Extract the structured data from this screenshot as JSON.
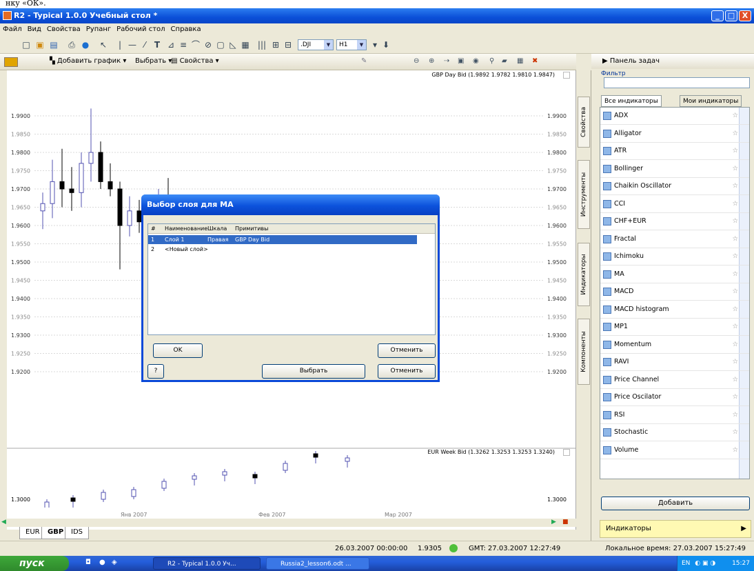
{
  "top_text": "нку «ОК».",
  "window": {
    "title": "R2 - Typical 1.0.0 Учебный стол *",
    "min": "_",
    "max": "□",
    "close": "X"
  },
  "menu": [
    "Файл",
    "Вид",
    "Свойства",
    "Рупанг",
    "Рабочий стол",
    "Справка"
  ],
  "toolbar": {
    "symbol_select": ".DJI",
    "interval_select": "H1"
  },
  "chart_toolbar": {
    "add_chart": "Добавить график",
    "select": "Выбрать",
    "properties": "Свойства"
  },
  "chart": {
    "top_label": "GBP Day Bid (1.9892 1.9782 1.9810 1.9847)",
    "bottom_label": "EUR Week Bid (1.3262 1.3253 1.3253 1.3240)",
    "y_ticks": [
      "1.9900",
      "1.9850",
      "1.9800",
      "1.9750",
      "1.9700",
      "1.9650",
      "1.9600",
      "1.9550",
      "1.9500",
      "1.9450",
      "1.9400",
      "1.9350",
      "1.9300",
      "1.9250",
      "1.9200"
    ],
    "bottom_y_tick": "1.3000",
    "x_ticks": [
      "Янв 2007",
      "Фев 2007",
      "Мар 2007"
    ]
  },
  "chart_data": {
    "type": "candlestick",
    "series": [
      {
        "name": "GBP Day Bid",
        "candles": [
          {
            "o": 1.964,
            "h": 1.969,
            "l": 1.959,
            "c": 1.966
          },
          {
            "o": 1.966,
            "h": 1.978,
            "l": 1.962,
            "c": 1.972
          },
          {
            "o": 1.972,
            "h": 1.981,
            "l": 1.965,
            "c": 1.97
          },
          {
            "o": 1.97,
            "h": 1.976,
            "l": 1.964,
            "c": 1.969
          },
          {
            "o": 1.969,
            "h": 1.98,
            "l": 1.965,
            "c": 1.977
          },
          {
            "o": 1.977,
            "h": 1.992,
            "l": 1.972,
            "c": 1.98
          },
          {
            "o": 1.98,
            "h": 1.983,
            "l": 1.97,
            "c": 1.972
          },
          {
            "o": 1.972,
            "h": 1.977,
            "l": 1.968,
            "c": 1.97
          },
          {
            "o": 1.97,
            "h": 1.972,
            "l": 1.948,
            "c": 1.96
          },
          {
            "o": 1.96,
            "h": 1.968,
            "l": 1.957,
            "c": 1.964
          },
          {
            "o": 1.964,
            "h": 1.967,
            "l": 1.958,
            "c": 1.961
          },
          {
            "o": 1.961,
            "h": 1.968,
            "l": 1.956,
            "c": 1.965
          },
          {
            "o": 1.965,
            "h": 1.97,
            "l": 1.962,
            "c": 1.968
          },
          {
            "o": 1.968,
            "h": 1.973,
            "l": 1.96,
            "c": 1.962
          }
        ]
      }
    ]
  },
  "dialog": {
    "title": "Выбор слоя для MA",
    "columns": [
      "#",
      "Наименование",
      "Шкала",
      "Примитивы"
    ],
    "rows": [
      {
        "num": "1",
        "name": "Слой 1",
        "scale": "Правая",
        "prims": "GBP Day Bid"
      },
      {
        "num": "2",
        "name": "<Новый слой>",
        "scale": "",
        "prims": ""
      }
    ],
    "ok": "OK",
    "cancel": "Отменить",
    "help": "?",
    "select_behind": "Выбрать",
    "cancel_behind": "Отменить"
  },
  "side_tabs": [
    "Свойства",
    "Инструменты",
    "Индикаторы",
    "Компоненты"
  ],
  "task_panel": {
    "header": "Панель задач",
    "filter_label": "Фильтр",
    "tab_all": "Все индикаторы",
    "tab_mine": "Мои индикаторы",
    "indicators": [
      "ADX",
      "Alligator",
      "ATR",
      "Bollinger",
      "Chaikin Oscillator",
      "CCI",
      "CHF+EUR",
      "Fractal",
      "Ichimoku",
      "MA",
      "MACD",
      "MACD histogram",
      "MP1",
      "Momentum",
      "RAVI",
      "Price Channel",
      "Price Oscilator",
      "RSI",
      "Stochastic",
      "Volume"
    ],
    "add_button": "Добавить",
    "bottom_bar": "Индикаторы"
  },
  "sheet_tabs": [
    "EUR",
    "GBP",
    "IDS"
  ],
  "status": {
    "datetime": "26.03.2007 00:00:00",
    "price": "1.9305",
    "gmt": "GMT: 27.03.2007 12:27:49",
    "local": "Локальное время: 27.03.2007 15:27:49"
  },
  "taskbar": {
    "start": "пуск",
    "task1": "R2 - Typical 1.0.0 Уч...",
    "task2": "Russia2_lesson6.odt ...",
    "lang": "EN",
    "clock": "15:27"
  }
}
